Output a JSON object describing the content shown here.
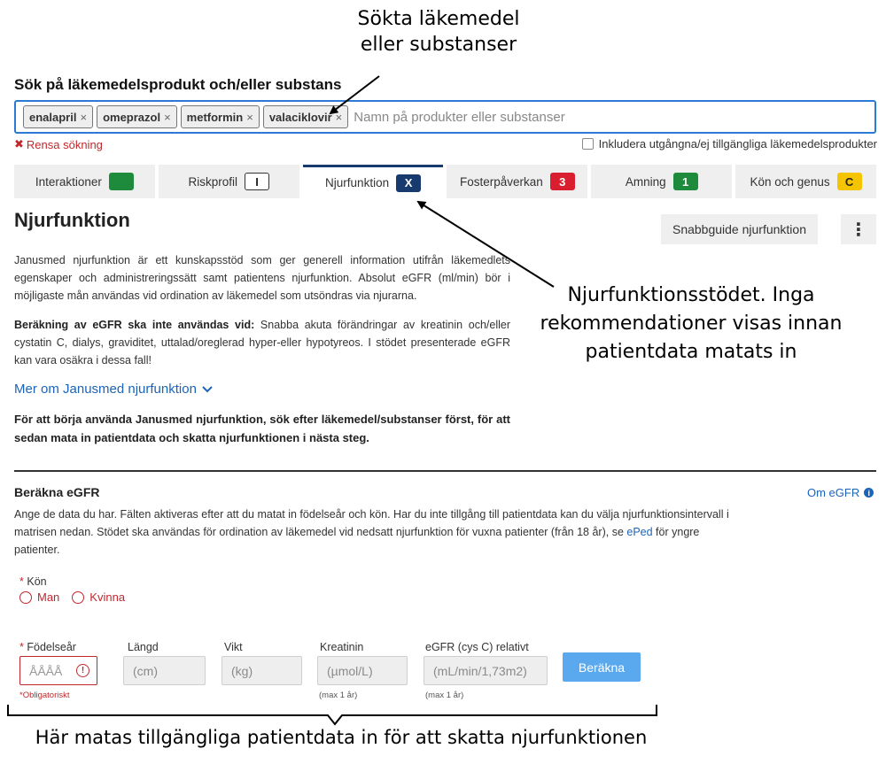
{
  "annotations": {
    "top": "Sökta läkemedel eller substanser",
    "middle": "Njurfunktionsstödet. Inga rekommendationer visas innan patientdata matats in",
    "bottom": "Här matas tillgängliga patientdata in för att skatta njurfunktionen"
  },
  "search": {
    "label": "Sök på läkemedelsprodukt och/eller substans",
    "chips": [
      "enalapril",
      "omeprazol",
      "metformin",
      "valaciklovir"
    ],
    "chip_remove": "×",
    "placeholder": "Namn på produkter eller substanser",
    "clear": "Rensa sökning",
    "clear_icon": "✖",
    "include_unavailable": "Inkludera utgångna/ej tillgängliga läkemedelsprodukter"
  },
  "tabs": [
    {
      "label": "Interaktioner",
      "badge": "",
      "badge_bg": "#1e8a3c",
      "badge_fg": "#ffffff",
      "badge_border": "#1e8a3c"
    },
    {
      "label": "Riskprofil",
      "badge": "I",
      "badge_bg": "#ffffff",
      "badge_fg": "#222222",
      "badge_border": "#333333"
    },
    {
      "label": "Njurfunktion",
      "badge": "X",
      "badge_bg": "#173b6e",
      "badge_fg": "#ffffff",
      "badge_border": "#173b6e"
    },
    {
      "label": "Fosterpåverkan",
      "badge": "3",
      "badge_bg": "#d81e2f",
      "badge_fg": "#ffffff",
      "badge_border": "#d81e2f"
    },
    {
      "label": "Amning",
      "badge": "1",
      "badge_bg": "#1e8a3c",
      "badge_fg": "#ffffff",
      "badge_border": "#1e8a3c"
    },
    {
      "label": "Kön och genus",
      "badge": "C",
      "badge_bg": "#f5c400",
      "badge_fg": "#222222",
      "badge_border": "#f5c400"
    }
  ],
  "page": {
    "title": "Njurfunktion",
    "quickguide": "Snabbguide njurfunktion",
    "more_icon": "⋮",
    "intro": "Janusmed njurfunktion är ett kunskapsstöd som ger generell information utifrån läkemedlets egenskaper och administreringssätt samt patientens njurfunktion. Absolut eGFR (ml/min) bör i möjligaste mån användas vid ordination av läkemedel som utsöndras via njurarna.",
    "warning_bold": "Beräkning av eGFR ska inte användas vid:",
    "warning_text": " Snabba akuta förändringar av kreatinin och/eller cystatin C, dialys, graviditet, uttalad/oreglerad hyper-eller hypotyreos. I stödet presenterade eGFR kan vara osäkra i dessa fall!",
    "more_link": "Mer om Janusmed njurfunktion",
    "more_link_icon": "⌄",
    "start_text": "För att börja använda Janusmed njurfunktion, sök efter läkemedel/substanser först, för att sedan mata in patientdata och skatta njurfunktionen i nästa steg."
  },
  "egfr": {
    "title": "Beräkna eGFR",
    "about_link": "Om eGFR",
    "about_icon": "i",
    "desc_before": "Ange de data du har. Fälten aktiveras efter att du matat in födelseår och kön. Har du inte tillgång till patientdata kan du välja njurfunktionsintervall i matrisen nedan. Stödet ska användas för ordination av läkemedel vid nedsatt njurfunktion för vuxna patienter (från 18 år), se ",
    "desc_link": "ePed",
    "desc_after": " för yngre patienter.",
    "sex_label": "Kön",
    "required_mark": "*",
    "sex_options": [
      "Man",
      "Kvinna"
    ],
    "fields": {
      "birthyear": {
        "label": "Födelseår",
        "placeholder": "ÅÅÅÅ",
        "hint": "*Obligatoriskt",
        "warn_icon": "!"
      },
      "height": {
        "label": "Längd",
        "placeholder": "(cm)"
      },
      "weight": {
        "label": "Vikt",
        "placeholder": "(kg)"
      },
      "creatinine": {
        "label": "Kreatinin",
        "placeholder": "(µmol/L)",
        "hint": "(max 1 år)"
      },
      "egfr_cys": {
        "label": "eGFR (cys C) relativt",
        "placeholder": "(mL/min/1,73m2)",
        "hint": "(max 1 år)"
      }
    },
    "calculate": "Beräkna"
  }
}
